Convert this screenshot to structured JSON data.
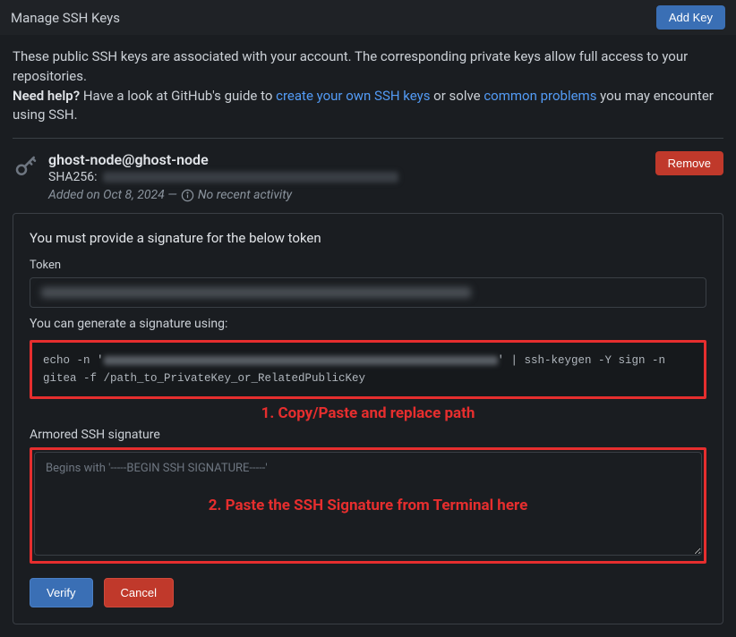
{
  "header": {
    "title": "Manage SSH Keys",
    "add_key_label": "Add Key"
  },
  "intro": {
    "line1_prefix": "These public SSH keys are associated with your account. The corresponding private keys allow full access to your repositories.",
    "need_help": "Need help?",
    "guide_prefix": " Have a look at GitHub's guide to ",
    "link1": "create your own SSH keys",
    "solve_text": " or solve ",
    "link2": "common problems",
    "suffix": " you may encounter using SSH."
  },
  "key": {
    "name": "ghost-node@ghost-node",
    "sha_prefix": "SHA256:",
    "added": "Added on Oct 8, 2024 — ",
    "activity": "No recent activity",
    "remove_label": "Remove"
  },
  "panel": {
    "heading": "You must provide a signature for the below token",
    "token_label": "Token",
    "generate_note": "You can generate a signature using:",
    "code_prefix": "echo -n '",
    "code_suffix": "' | ssh-keygen -Y sign -n gitea -f /path_to_PrivateKey_or_RelatedPublicKey",
    "annotation1": "1. Copy/Paste and replace path",
    "sig_label": "Armored SSH signature",
    "sig_placeholder": "Begins with '-----BEGIN SSH SIGNATURE-----'",
    "annotation2": "2. Paste the SSH Signature from Terminal here",
    "verify_label": "Verify",
    "cancel_label": "Cancel"
  }
}
